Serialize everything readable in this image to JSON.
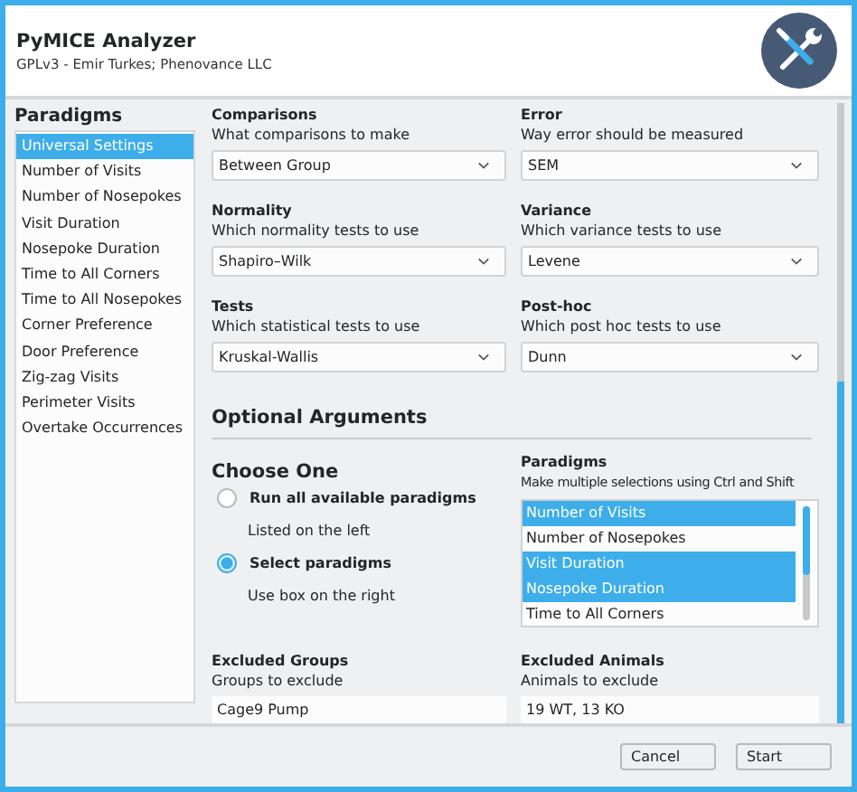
{
  "window": {
    "title": "PyMICE Analyzer",
    "subtitle": "GPLv3 - Emir Turkes; Phenovance LLC"
  },
  "sidebar": {
    "heading": "Paradigms",
    "items": [
      {
        "label": "Universal Settings",
        "selected": true
      },
      {
        "label": "Number of Visits",
        "selected": false
      },
      {
        "label": "Number of Nosepokes",
        "selected": false
      },
      {
        "label": "Visit Duration",
        "selected": false
      },
      {
        "label": "Nosepoke Duration",
        "selected": false
      },
      {
        "label": "Time to All Corners",
        "selected": false
      },
      {
        "label": "Time to All Nosepokes",
        "selected": false
      },
      {
        "label": "Corner Preference",
        "selected": false
      },
      {
        "label": "Door Preference",
        "selected": false
      },
      {
        "label": "Zig-zag Visits",
        "selected": false
      },
      {
        "label": "Perimeter Visits",
        "selected": false
      },
      {
        "label": "Overtake Occurrences",
        "selected": false
      }
    ]
  },
  "settings": [
    {
      "label": "Comparisons",
      "description": "What comparisons to make",
      "value": "Between Group"
    },
    {
      "label": "Error",
      "description": "Way error should be measured",
      "value": "SEM"
    },
    {
      "label": "Normality",
      "description": "Which normality tests to use",
      "value": "Shapiro–Wilk"
    },
    {
      "label": "Variance",
      "description": "Which variance tests to use",
      "value": "Levene"
    },
    {
      "label": "Tests",
      "description": "Which statistical tests to use",
      "value": "Kruskal-Wallis"
    },
    {
      "label": "Post-hoc",
      "description": "Which post hoc tests to use",
      "value": "Dunn"
    }
  ],
  "optional": {
    "heading": "Optional Arguments",
    "choice": {
      "heading": "Choose One",
      "options": [
        {
          "label": "Run all available paradigms",
          "note": "Listed on the left",
          "selected": false
        },
        {
          "label": "Select paradigms",
          "note": "Use box on the right",
          "selected": true
        }
      ]
    },
    "paradigms": {
      "label": "Paradigms",
      "description": "Make multiple selections using Ctrl and Shift",
      "items": [
        {
          "label": "Number of Visits",
          "selected": true
        },
        {
          "label": "Number of Nosepokes",
          "selected": false
        },
        {
          "label": "Visit Duration",
          "selected": true
        },
        {
          "label": "Nosepoke Duration",
          "selected": true
        },
        {
          "label": "Time to All Corners",
          "selected": false
        }
      ]
    },
    "excluded_groups": {
      "label": "Excluded Groups",
      "description": "Groups to exclude",
      "value": "Cage9 Pump"
    },
    "excluded_animals": {
      "label": "Excluded Animals",
      "description": "Animals to exclude",
      "value": "19 WT, 13 KO"
    }
  },
  "buttons": [
    "Cancel",
    "Start"
  ]
}
